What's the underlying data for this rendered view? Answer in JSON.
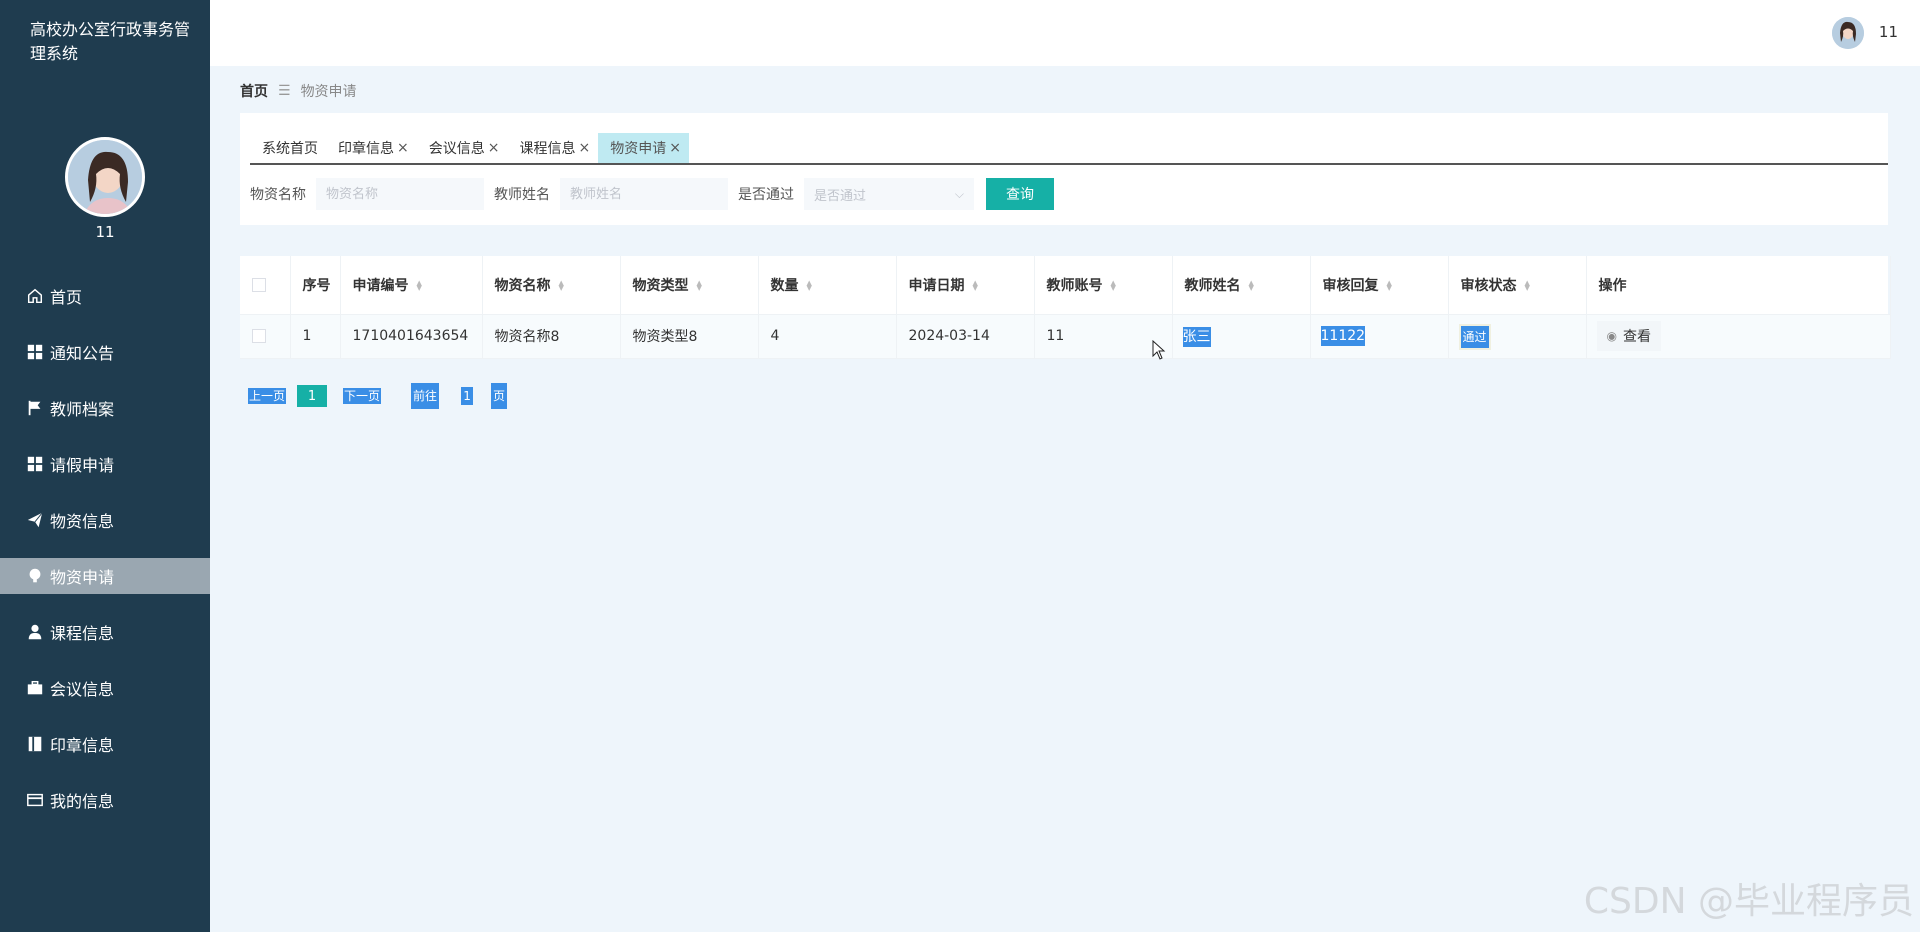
{
  "app": {
    "title": "高校办公室行政事务管理系统",
    "username": "11"
  },
  "sidebar": {
    "username": "11",
    "items": [
      {
        "label": "首页",
        "icon": "home-icon"
      },
      {
        "label": "通知公告",
        "icon": "grid-icon"
      },
      {
        "label": "教师档案",
        "icon": "flag-icon"
      },
      {
        "label": "请假申请",
        "icon": "grid-icon"
      },
      {
        "label": "物资信息",
        "icon": "paper-plane-icon"
      },
      {
        "label": "物资申请",
        "icon": "bulb-icon",
        "active": true
      },
      {
        "label": "课程信息",
        "icon": "user-icon"
      },
      {
        "label": "会议信息",
        "icon": "briefcase-icon"
      },
      {
        "label": "印章信息",
        "icon": "book-icon"
      },
      {
        "label": "我的信息",
        "icon": "card-icon"
      }
    ]
  },
  "header": {
    "username": "11"
  },
  "breadcrumb": {
    "home": "首页",
    "current": "物资申请"
  },
  "tabs": [
    {
      "label": "系统首页",
      "closable": false
    },
    {
      "label": "印章信息",
      "closable": true
    },
    {
      "label": "会议信息",
      "closable": true
    },
    {
      "label": "课程信息",
      "closable": true
    },
    {
      "label": "物资申请",
      "closable": true,
      "active": true
    }
  ],
  "tab_close": "×",
  "filters": {
    "material_name_label": "物资名称",
    "material_name_placeholder": "物资名称",
    "teacher_name_label": "教师姓名",
    "teacher_name_placeholder": "教师姓名",
    "passed_label": "是否通过",
    "passed_placeholder": "是否通过",
    "query_button": "查询"
  },
  "table": {
    "columns": [
      "序号",
      "申请编号",
      "物资名称",
      "物资类型",
      "数量",
      "申请日期",
      "教师账号",
      "教师姓名",
      "审核回复",
      "审核状态",
      "操作"
    ],
    "rows": [
      {
        "index": "1",
        "apply_no": "1710401643654",
        "material_name": "物资名称8",
        "material_type": "物资类型8",
        "quantity": "4",
        "apply_date": "2024-03-14",
        "teacher_account": "11",
        "teacher_name": "张三",
        "review_reply": "11122",
        "review_status": "通过",
        "action": "查看"
      }
    ]
  },
  "pagination": {
    "prev": "上一页",
    "current": "1",
    "next": "下一页",
    "goto": "前往",
    "page_input": "1",
    "suffix": "页"
  },
  "watermark": "CSDN @毕业程序员",
  "colors": {
    "sidebar_bg": "#1f3c4f",
    "accent": "#16b0a6",
    "selection": "#3a8ee6",
    "page_bg": "#eef5fb"
  }
}
